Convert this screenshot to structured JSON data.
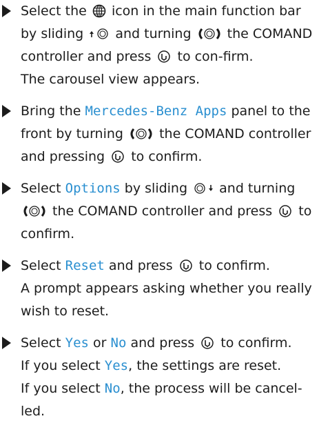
{
  "steps": [
    {
      "part1": "Select the",
      "part2": "icon in the main function bar by sliding",
      "part3": "and turning",
      "part4": "the COMAND controller and press",
      "part5": "to con-firm.",
      "result": "The carousel view appears."
    },
    {
      "part1": "Bring the",
      "highlight": "Mercedes-Benz Apps",
      "part2": "panel to the front by turning",
      "part3": "the COMAND controller and pressing",
      "part4": "to confirm."
    },
    {
      "part1": "Select",
      "highlight": "Options",
      "part2": "by sliding",
      "part3": "and turning",
      "part4": "the COMAND controller and press",
      "part5": "to confirm."
    },
    {
      "part1": "Select",
      "highlight": "Reset",
      "part2": "and press",
      "part3": "to confirm.",
      "result": "A prompt appears asking whether you really wish to reset."
    },
    {
      "part1": "Select",
      "highlight1": "Yes",
      "part2": "or",
      "highlight2": "No",
      "part3": "and press",
      "part4": "to confirm.",
      "result1_pre": "If you select",
      "result1_highlight": "Yes",
      "result1_post": ", the settings are reset.",
      "result2_pre": "If you select",
      "result2_highlight": "No",
      "result2_post": ", the process will be cancel-led."
    }
  ],
  "icons": {
    "globe": "globe-icon",
    "slide_up": "controller-slide-up-icon",
    "slide_down": "controller-slide-down-icon",
    "turn": "controller-turn-icon",
    "press": "controller-press-icon"
  },
  "colors": {
    "text": "#1c1c1c",
    "highlight": "#2a8fd0"
  }
}
